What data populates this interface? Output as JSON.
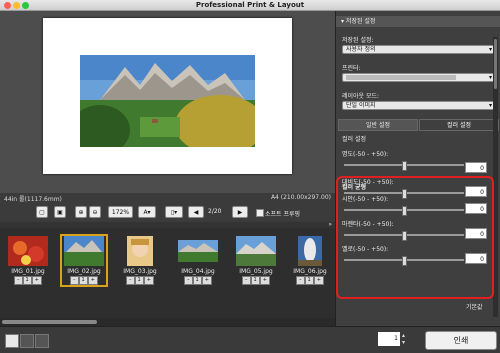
{
  "window": {
    "title": "Professional Print & Layout"
  },
  "preview": {
    "paper_size": "44in 롤(1117.6mm)",
    "page_size": "A4 (210.00x297.00)"
  },
  "toolbar": {
    "zoom": "172%",
    "page_indicator": "2/20",
    "soft_proof_label": "소프트 프루핑"
  },
  "thumbnails": [
    {
      "name": "IMG_01.jpg",
      "count": "1"
    },
    {
      "name": "IMG_02.jpg",
      "count": "1"
    },
    {
      "name": "IMG_03.jpg",
      "count": "1"
    },
    {
      "name": "IMG_04.jpg",
      "count": "1"
    },
    {
      "name": "IMG_05.jpg",
      "count": "1"
    },
    {
      "name": "IMG_06.jpg",
      "count": "1"
    }
  ],
  "panel": {
    "saved_settings_header": "저장된 설정",
    "saved_settings_label": "저장된 설정:",
    "saved_settings_value": "사용자 정의",
    "printer_label": "프린터:",
    "layout_mode_label": "레이아웃 모드:",
    "layout_mode_value": "단일 이미지",
    "tab_general": "일반 설정",
    "tab_color": "컬러 설정",
    "color_settings_header": "컬러 설정",
    "brightness_label": "명도(-50 - +50):",
    "brightness_value": "0",
    "contrast_label": "대비도(-50 - +50):",
    "contrast_value": "0",
    "color_balance_label": "컬러 균형",
    "cyan_label": "시안(-50 - +50):",
    "cyan_value": "0",
    "magenta_label": "마젠타(-50 - +50):",
    "magenta_value": "0",
    "yellow_label": "옐로(-50 - +50):",
    "yellow_value": "0",
    "partial_label": "기본값"
  },
  "bottom": {
    "copies": "1",
    "print_button": "인쇄"
  },
  "colors": {
    "highlight": "#e02020",
    "panel_bg": "#3f3f3f"
  }
}
